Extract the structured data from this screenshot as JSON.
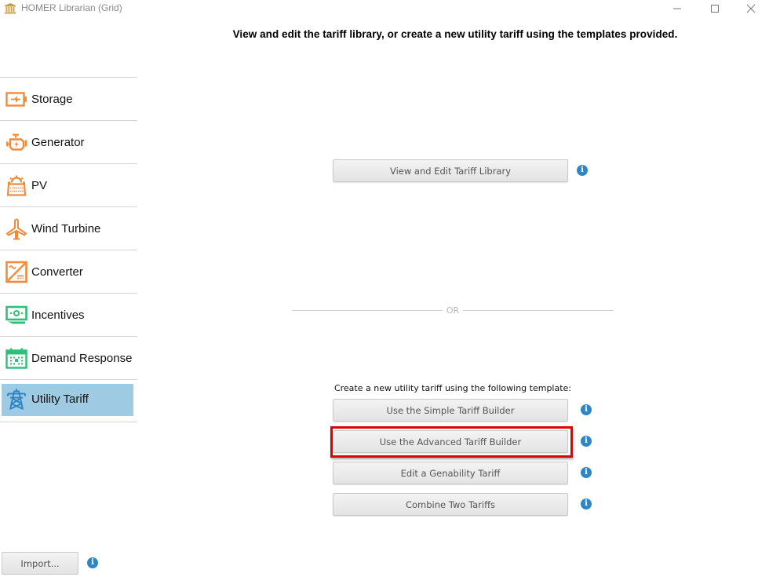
{
  "window": {
    "title": "HOMER Librarian (Grid)",
    "icon": "library-building-icon",
    "controls": [
      "minimize-icon",
      "maximize-icon",
      "close-icon"
    ]
  },
  "headline": "View and edit the tariff library, or create a new utility tariff using the templates provided.",
  "sidebar": {
    "items": [
      {
        "label": "Storage",
        "icon": "battery-icon",
        "color": "#f28a3b",
        "active": false
      },
      {
        "label": "Generator",
        "icon": "engine-icon",
        "color": "#f28a3b",
        "active": false
      },
      {
        "label": "PV",
        "icon": "solar-panel-icon",
        "color": "#f28a3b",
        "active": false
      },
      {
        "label": "Wind Turbine",
        "icon": "wind-turbine-icon",
        "color": "#f28a3b",
        "active": false
      },
      {
        "label": "Converter",
        "icon": "converter-icon",
        "color": "#f28a3b",
        "active": false
      },
      {
        "label": "Incentives",
        "icon": "money-icon",
        "color": "#2ebf7a",
        "active": false
      },
      {
        "label": "Demand Response",
        "icon": "calendar-icon",
        "color": "#2ebf7a",
        "active": false
      },
      {
        "label": "Utility Tariff",
        "icon": "transmission-tower-icon",
        "color": "#2f86c6",
        "active": true
      }
    ]
  },
  "main": {
    "view_library_button": "View and Edit Tariff Library",
    "or_divider": "OR",
    "create_label": "Create a new utility tariff using the following template:",
    "template_buttons": [
      {
        "label": "Use the Simple Tariff Builder",
        "highlighted": false
      },
      {
        "label": "Use the Advanced Tariff Builder",
        "highlighted": true
      },
      {
        "label": "Edit a Genability Tariff",
        "highlighted": false
      },
      {
        "label": "Combine Two Tariffs",
        "highlighted": false
      }
    ],
    "info_glyph": "i"
  },
  "footer": {
    "import_button": "Import..."
  },
  "colors": {
    "accent_orange": "#f28a3b",
    "accent_green": "#2ebf7a",
    "accent_blue": "#2f86c6",
    "selection": "#9ecae4",
    "highlight_red": "#e00000"
  }
}
